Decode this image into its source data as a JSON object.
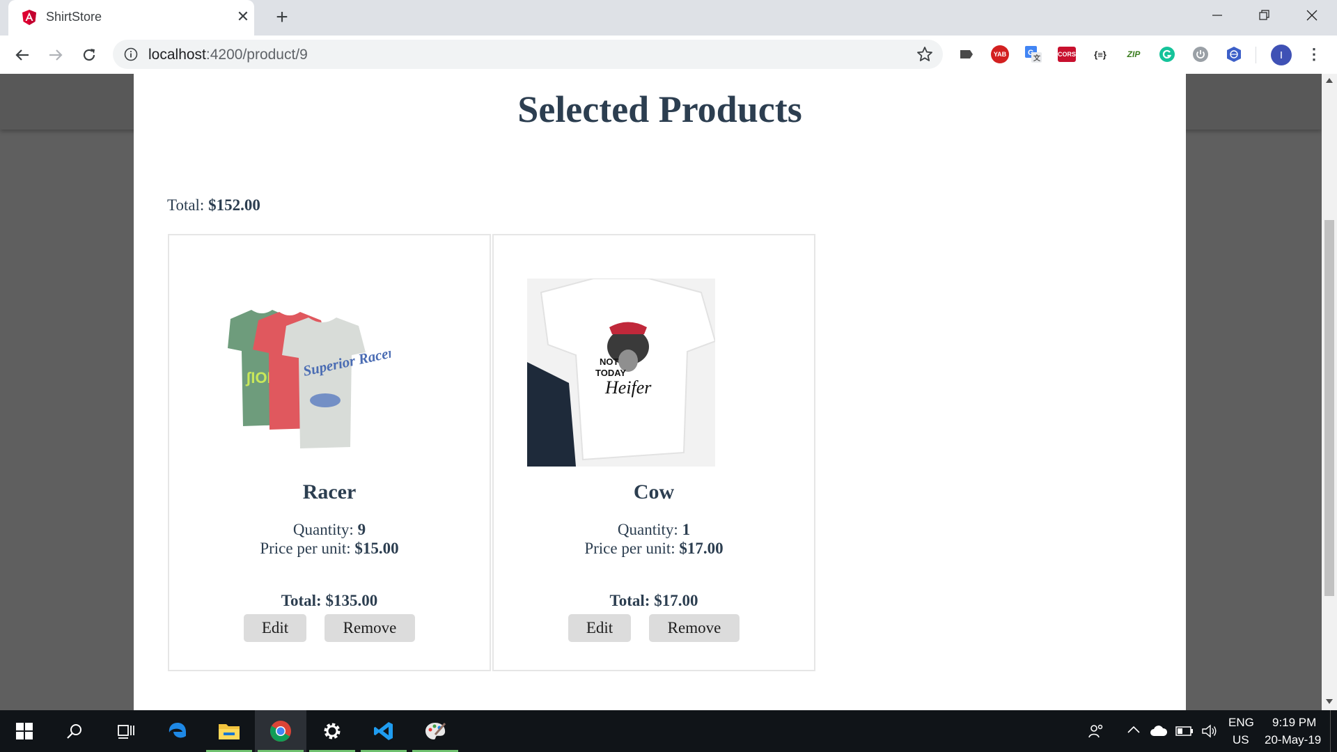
{
  "browser": {
    "tab_title": "ShirtStore",
    "url_host": "localhost",
    "url_path": ":4200/product/9",
    "extensions": [
      "YAB",
      "CORS",
      "{≡}",
      "ZIP"
    ],
    "profile_initial": "I"
  },
  "page": {
    "title": "Selected Products",
    "total_label": "Total:",
    "total_value": "$152.00",
    "products": [
      {
        "name": "Racer",
        "quantity_label": "Quantity:",
        "quantity": "9",
        "price_label": "Price per unit:",
        "price": "$15.00",
        "total_label": "Total:",
        "total": "$135.00",
        "edit_label": "Edit",
        "remove_label": "Remove",
        "shirt_text": "Superior Racer"
      },
      {
        "name": "Cow",
        "quantity_label": "Quantity:",
        "quantity": "1",
        "price_label": "Price per unit:",
        "price": "$17.00",
        "total_label": "Total:",
        "total": "$17.00",
        "edit_label": "Edit",
        "remove_label": "Remove",
        "shirt_text_1": "NOT",
        "shirt_text_2": "TODAY",
        "shirt_text_3": "Heifer"
      }
    ]
  },
  "taskbar": {
    "language_1": "ENG",
    "language_2": "US",
    "time": "9:19 PM",
    "date": "20-May-19"
  },
  "colors": {
    "text": "#2c3e50",
    "button_bg": "#dcdcdc",
    "taskbar_bg": "#101418",
    "chrome_bg": "#dee1e6"
  }
}
